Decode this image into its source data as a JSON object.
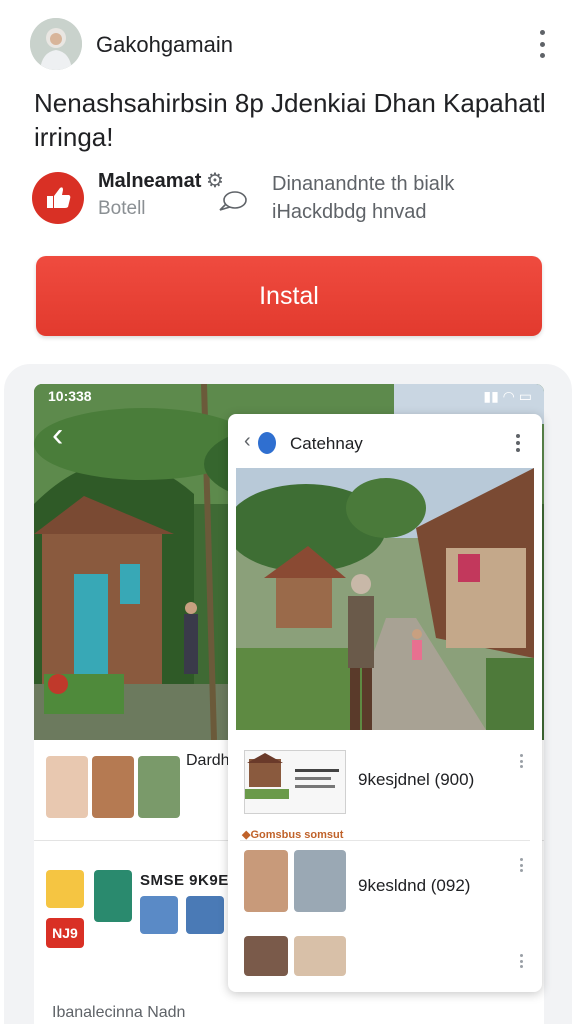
{
  "header": {
    "app_name": "Gakohgamain",
    "more_icon": "more-vert-icon",
    "avatar_icon": "avatar"
  },
  "headline": "Nenashsahirbsin 8p Jdenkiai Dhan Kapahatl irringa!",
  "developer": {
    "name": "Malneamat",
    "verified_icon": "gear-icon",
    "sub": "Botell",
    "chat_icon": "chat-bubble-icon",
    "description": "Dinanandnte th bialk iHackdbdg hnvad"
  },
  "install": {
    "label": "Instal",
    "color": "#e8453a"
  },
  "screenshot_back": {
    "status_time": "10:338",
    "status_icons": "▮▮ ◠ ▭",
    "back_arrow": "‹",
    "row1_label": "Dardh",
    "row2_label": "SMSE 9K9E",
    "badge_text": "NJ9",
    "footer": "Ibanalecinna Nadn"
  },
  "card": {
    "back_arrow": "‹",
    "title": "Catehnay",
    "items": [
      {
        "label": "9kesjdnel (900)"
      },
      {
        "label": "9kesldnd (092)"
      }
    ],
    "tag": "◆Gomsbus somsut"
  },
  "colors": {
    "accent_red": "#e8453a",
    "text_primary": "#202124",
    "text_secondary": "#5f6368"
  }
}
